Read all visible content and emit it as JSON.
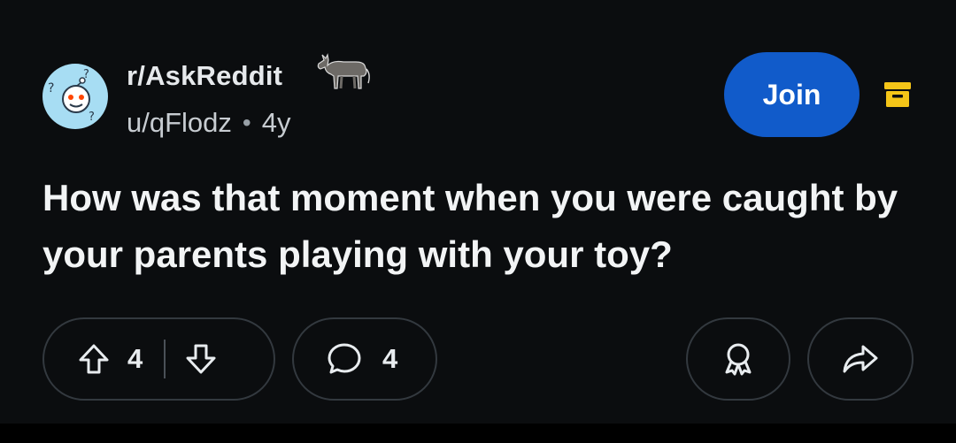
{
  "post": {
    "subreddit": "r/AskReddit",
    "author": "u/qFlodz",
    "separator": "•",
    "age": "4y",
    "title": "How was that moment when you were caught by your parents playing with your toy?"
  },
  "actions": {
    "join_label": "Join",
    "upvote_count": "4",
    "comment_count": "4"
  },
  "icons": [
    "subreddit-avatar-icon",
    "donkey-flair-icon",
    "archive-icon",
    "upvote-icon",
    "downvote-icon",
    "comment-icon",
    "award-icon",
    "share-icon"
  ],
  "colors": {
    "background": "#0b0d0f",
    "join_button": "#115bca",
    "archive_icon": "#f5c518",
    "avatar_bg": "#a7ddf3"
  }
}
